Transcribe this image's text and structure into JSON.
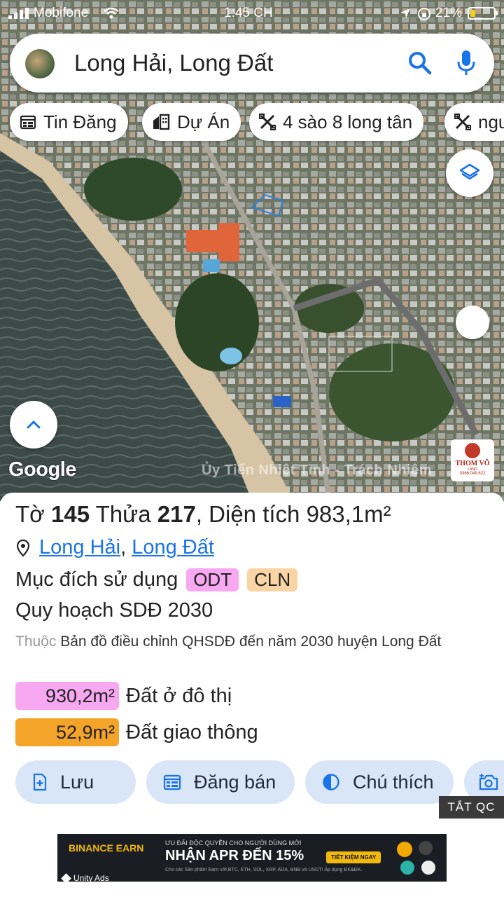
{
  "status_bar": {
    "carrier": "Mobifone",
    "time": "1:45 CH",
    "battery_percent": "21%",
    "battery_level": 0.21
  },
  "search": {
    "query": "Long Hải, Long Đất"
  },
  "chips": [
    {
      "label": "Tin Đăng",
      "icon": "calendar-icon"
    },
    {
      "label": "Dự Án",
      "icon": "buildings-icon"
    },
    {
      "label": "4 sào 8 long tân",
      "icon": "ruler-pencil-icon"
    },
    {
      "label": "ngu",
      "icon": "ruler-pencil-icon"
    }
  ],
  "map": {
    "google_logo": "Google",
    "watermark": "Ủy Tiến Nhiệt Tình - Trách Nhiệm",
    "brand": {
      "name": "THOM VÕ",
      "sub": "LAND",
      "phone": "0366.049.622"
    }
  },
  "parcel": {
    "prefix_sheet": "Tờ",
    "sheet": "145",
    "prefix_plot": "Thửa",
    "plot": "217",
    "area_text": ", Diện tích",
    "area": "983,1m²",
    "locations": [
      "Long Hải",
      "Long Đất"
    ],
    "separator": ",",
    "purpose_label": "Mục đích sử dụng",
    "purposes": [
      {
        "code": "ODT",
        "color": "#f7a8f0"
      },
      {
        "code": "CLN",
        "color": "#f9d5a5"
      }
    ],
    "plan_label": "Quy hoạch SDĐ 2030",
    "belongs_prefix": "Thuộc",
    "belongs_text": "Bản đồ điều chỉnh QHSDĐ đến năm 2030 huyện Long Đất",
    "land_use": [
      {
        "value": "930,2m²",
        "name": "Đất ở đô thị",
        "color": "#f7a8f0"
      },
      {
        "value": "52,9m²",
        "name": "Đất giao thông",
        "color": "#f5a42a"
      }
    ]
  },
  "actions": [
    {
      "label": "Lưu",
      "icon": "bookmark-add-icon"
    },
    {
      "label": "Đăng bán",
      "icon": "calendar-icon"
    },
    {
      "label": "Chú thích",
      "icon": "contrast-icon"
    },
    {
      "label": "",
      "icon": "add-photo-icon"
    }
  ],
  "ad": {
    "close_label": "TẮT QC",
    "brand": "BINANCE EARN",
    "line1": "ƯU ĐÃI ĐỘC QUYỀN CHO NGƯỜI DÙNG MỚI",
    "headline": "NHẬN APR ĐẾN 15%",
    "cta": "TIẾT KIỆM NGAY",
    "line3": "Cho các Sản phẩm Earn với BTC, ETH, SOL, XRP, ADA, BNB và USDT! Áp dụng ĐK&ĐK.",
    "provider": "Unity Ads"
  },
  "colors": {
    "link": "#1a73e8",
    "action_bg": "#d9e6f8",
    "odt": "#f7a8f0",
    "cln": "#f9d5a5",
    "road": "#f5a42a"
  }
}
